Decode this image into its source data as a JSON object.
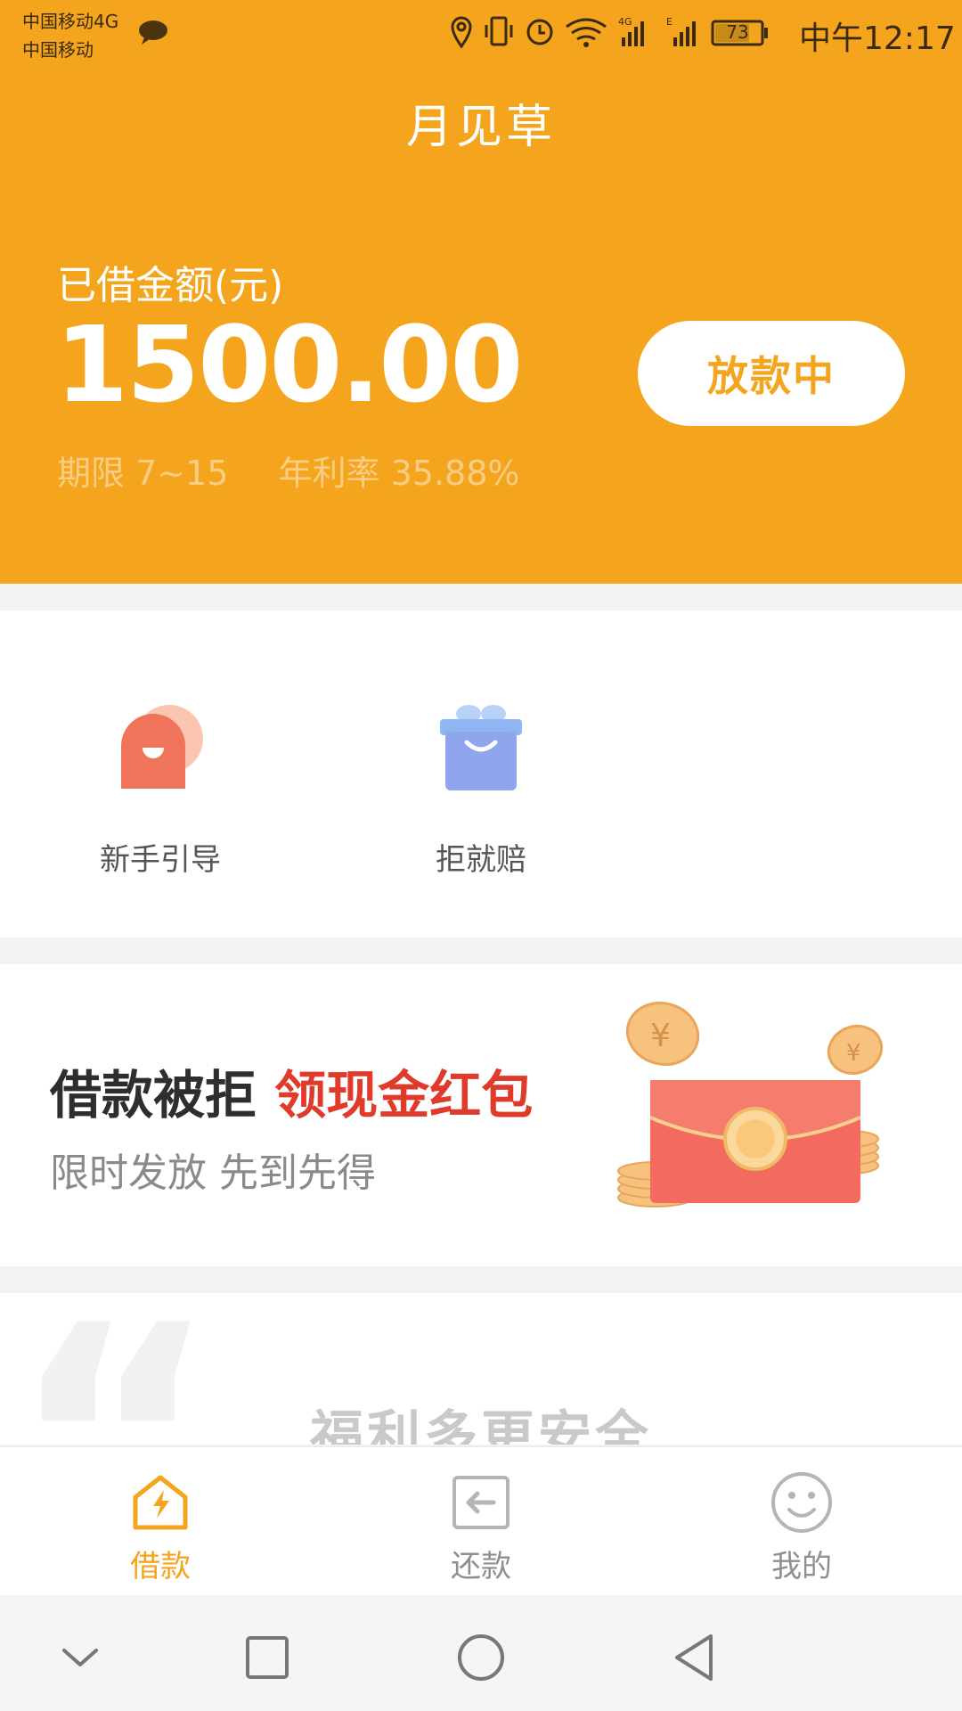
{
  "status_bar": {
    "carrier_line1": "中国移动4G",
    "carrier_line2": "中国移动",
    "battery": "73",
    "time": "中午12:17"
  },
  "header": {
    "title": "月见草",
    "amount_label": "已借金额(元)",
    "amount_value": "1500.00",
    "status_button": "放款中",
    "term": "期限 7~15",
    "annual_rate": "年利率 35.88%"
  },
  "features": [
    {
      "label": "新手引导",
      "icon": "chat-bubble-icon"
    },
    {
      "label": "拒就赔",
      "icon": "shopping-bag-icon"
    }
  ],
  "banner": {
    "title_main": "借款被拒 ",
    "title_highlight": "领现金红包",
    "subtitle": "限时发放 先到先得",
    "art": "red-envelope-coins-illustration"
  },
  "partial_card": {
    "text": "福利多更安全"
  },
  "tabbar": {
    "tabs": [
      {
        "label": "借款",
        "icon": "lightning-house-icon",
        "active": true
      },
      {
        "label": "还款",
        "icon": "return-arrow-icon",
        "active": false
      },
      {
        "label": "我的",
        "icon": "smiley-icon",
        "active": false
      }
    ]
  },
  "colors": {
    "brand": "#f4a51d",
    "highlight": "#e03a2a"
  }
}
